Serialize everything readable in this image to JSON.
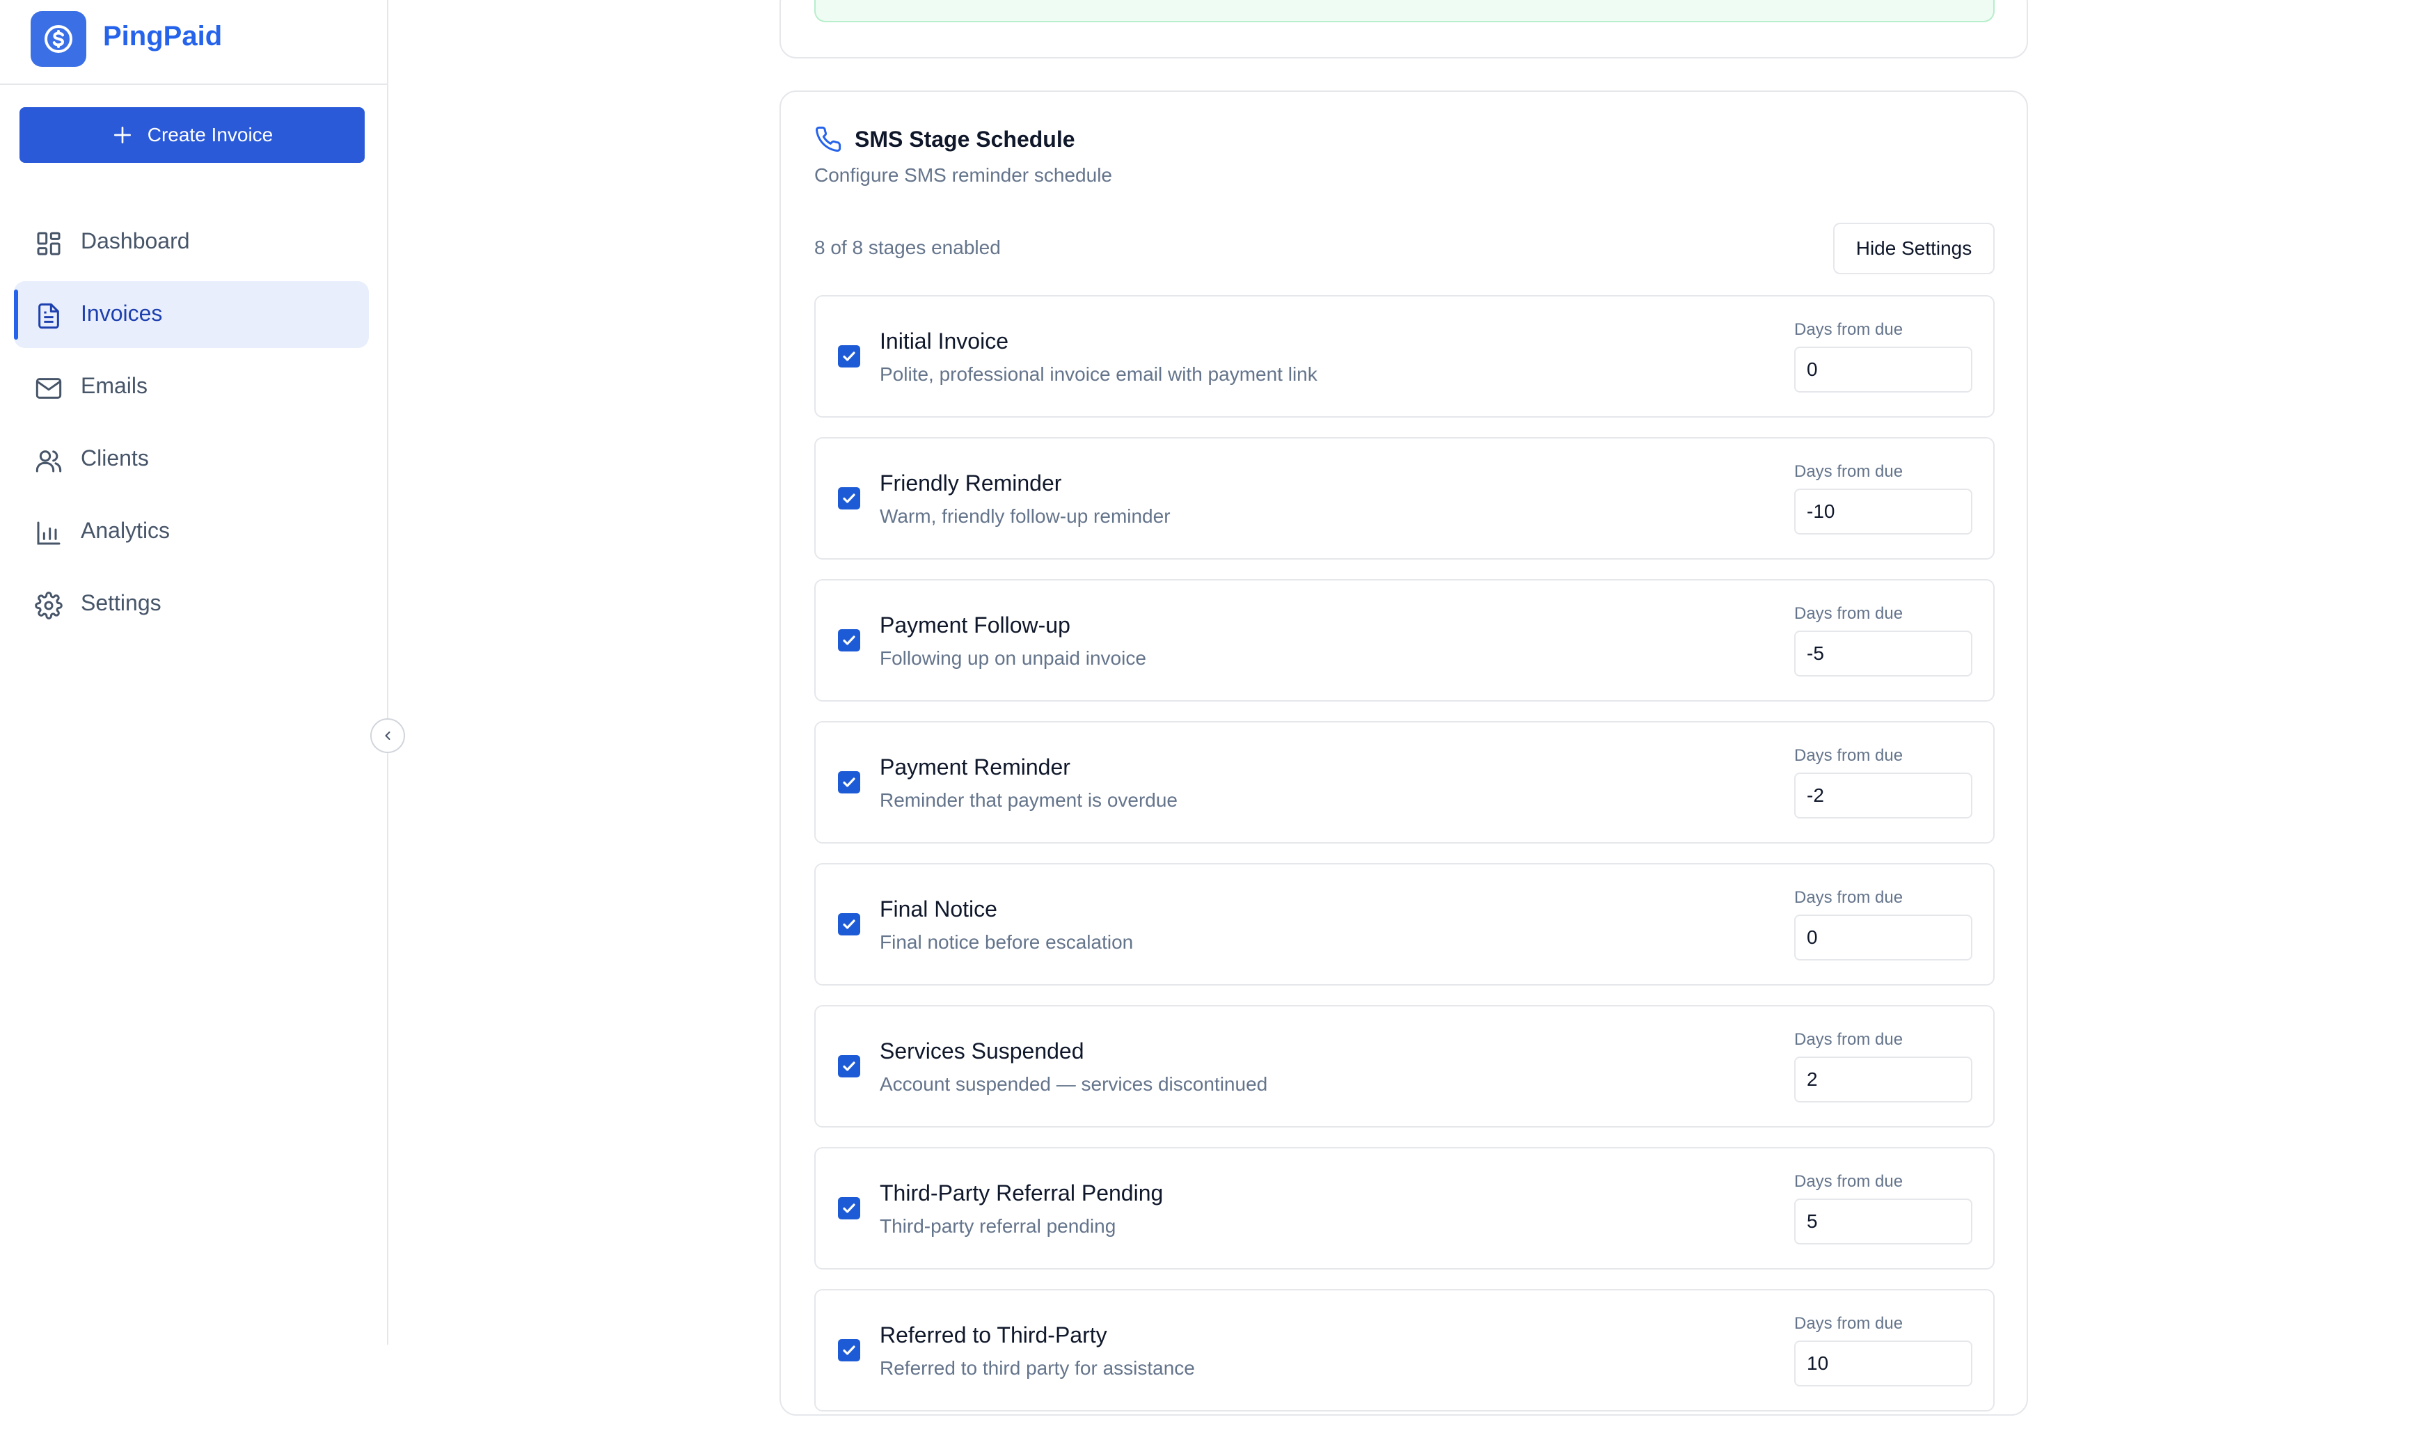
{
  "brand": {
    "name": "PingPaid"
  },
  "sidebar": {
    "create_label": "Create Invoice",
    "items": [
      {
        "label": "Dashboard",
        "icon": "dashboard-icon"
      },
      {
        "label": "Invoices",
        "icon": "document-icon",
        "active": true
      },
      {
        "label": "Emails",
        "icon": "mail-icon"
      },
      {
        "label": "Clients",
        "icon": "users-icon"
      },
      {
        "label": "Analytics",
        "icon": "bar-chart-icon"
      },
      {
        "label": "Settings",
        "icon": "gear-icon"
      }
    ]
  },
  "sms": {
    "title": "SMS Stage Schedule",
    "subtitle": "Configure SMS reminder schedule",
    "count": "8 of 8 stages enabled",
    "hide_label": "Hide Settings",
    "days_label": "Days from due",
    "stages": [
      {
        "title": "Initial Invoice",
        "desc": "Polite, professional invoice email with payment link",
        "days": "0",
        "enabled": true
      },
      {
        "title": "Friendly Reminder",
        "desc": "Warm, friendly follow-up reminder",
        "days": "-10",
        "enabled": true
      },
      {
        "title": "Payment Follow-up",
        "desc": "Following up on unpaid invoice",
        "days": "-5",
        "enabled": true
      },
      {
        "title": "Payment Reminder",
        "desc": "Reminder that payment is overdue",
        "days": "-2",
        "enabled": true
      },
      {
        "title": "Final Notice",
        "desc": "Final notice before escalation",
        "days": "0",
        "enabled": true
      },
      {
        "title": "Services Suspended",
        "desc": "Account suspended — services discontinued",
        "days": "2",
        "enabled": true
      },
      {
        "title": "Third-Party Referral Pending",
        "desc": "Third-party referral pending",
        "days": "5",
        "enabled": true
      },
      {
        "title": "Referred to Third-Party",
        "desc": "Referred to third party for assistance",
        "days": "10",
        "enabled": true
      }
    ]
  },
  "colors": {
    "accent": "#2563eb",
    "button": "#2a5ad8",
    "checkbox": "#1d5bd6"
  }
}
